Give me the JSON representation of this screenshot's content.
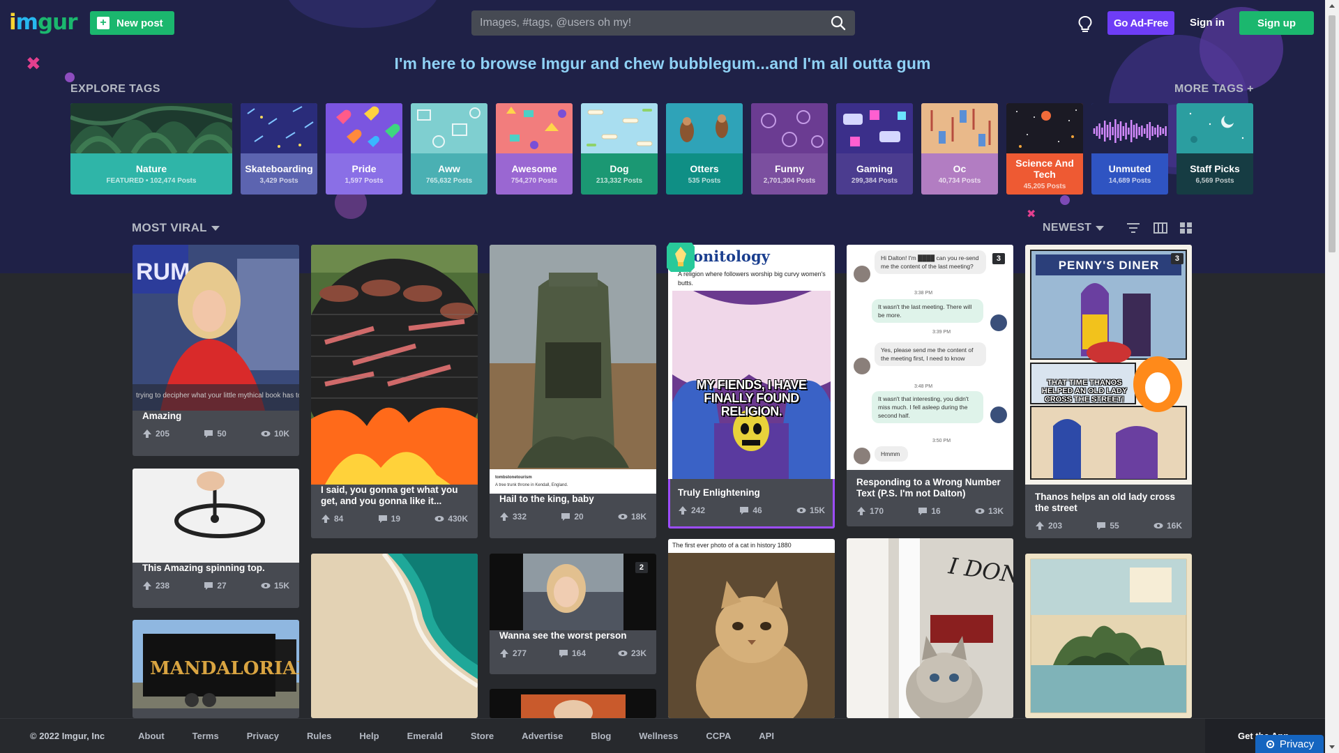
{
  "header": {
    "logo_text": "imgur",
    "new_post_label": "New post",
    "search_placeholder": "Images, #tags, @users oh my!",
    "go_ad_free_label": "Go Ad-Free",
    "sign_in_label": "Sign in",
    "sign_up_label": "Sign up",
    "icons": [
      "plus-icon",
      "search-icon",
      "lightbulb-icon"
    ]
  },
  "tagline": "I'm here to browse Imgur and chew bubblegum...and I'm all outta gum",
  "explore": {
    "title": "EXPLORE TAGS",
    "more_label": "MORE TAGS +",
    "tags": [
      {
        "name": "Nature",
        "count": "FEATURED • 102,474 Posts",
        "color": "#2fb5a8"
      },
      {
        "name": "Skateboarding",
        "count": "3,429 Posts",
        "color": "#5c64b0"
      },
      {
        "name": "Pride",
        "count": "1,597 Posts",
        "color": "#8a6fe6"
      },
      {
        "name": "Aww",
        "count": "765,632 Posts",
        "color": "#4ab0b3"
      },
      {
        "name": "Awesome",
        "count": "754,270 Posts",
        "color": "#9a67d2"
      },
      {
        "name": "Dog",
        "count": "213,332 Posts",
        "color": "#1b9873"
      },
      {
        "name": "Otters",
        "count": "535 Posts",
        "color": "#0f8f85"
      },
      {
        "name": "Funny",
        "count": "2,701,304 Posts",
        "color": "#7b4f9f"
      },
      {
        "name": "Gaming",
        "count": "299,384 Posts",
        "color": "#4b3c8f"
      },
      {
        "name": "Oc",
        "count": "40,734 Posts",
        "color": "#b27dc2"
      },
      {
        "name": "Science And Tech",
        "count": "45,205 Posts",
        "color": "#ee5a33"
      },
      {
        "name": "Unmuted",
        "count": "14,689 Posts",
        "color": "#2f54c2"
      },
      {
        "name": "Staff Picks",
        "count": "6,569 Posts",
        "color": "#163c43"
      }
    ]
  },
  "feed": {
    "section_label": "MOST VIRAL",
    "sort_label": "NEWEST",
    "posts": [
      {
        "title": "Amazing",
        "ups": "205",
        "comments": "50",
        "views": "10K",
        "caption": "trying to decipher what your little mythical book has to say"
      },
      {
        "title": "This Amazing spinning top.",
        "ups": "238",
        "comments": "27",
        "views": "15K"
      },
      {
        "title": "I said, you gonna get what you get, and you gonna like it...",
        "ups": "84",
        "comments": "19",
        "views": "430K"
      },
      {
        "title": "Hail to the king, baby",
        "ups": "332",
        "comments": "20",
        "views": "18K",
        "source": "tombstonetourism",
        "source_caption": "A tree trunk throne in Kendall, England."
      },
      {
        "title": "Wanna see the worst person",
        "ups": "277",
        "comments": "164",
        "views": "23K",
        "badge": "2"
      },
      {
        "title": "Truly Enlightening",
        "ups": "242",
        "comments": "46",
        "views": "15K",
        "heading": "onitology",
        "subheading": "A religion where followers worship big curvy women's butts.",
        "meme_text": "MY FIENDS, I HAVE FINALLY FOUND RELIGION."
      },
      {
        "title": "Responding to a Wrong Number Text (P.S. I'm not Dalton)",
        "ups": "170",
        "comments": "16",
        "views": "13K",
        "badge": "3"
      },
      {
        "title": "Thanos helps an old lady cross the street",
        "ups": "203",
        "comments": "55",
        "views": "16K",
        "badge": "3",
        "comic_title": "PENNY'S DINER",
        "comic_caption": "THAT TIME THANOS HELPED AN OLD LADY CROSS THE STREET!"
      },
      {
        "title": "The first ever photo of a cat in history 1880"
      }
    ],
    "chat": [
      {
        "from": "them",
        "text": "Hi Dalton! I'm ████ can you re-send me the content of the last meeting?",
        "time": "3:38 PM"
      },
      {
        "from": "me",
        "text": "It wasn't the last meeting. There will be more.",
        "time": "3:39 PM"
      },
      {
        "from": "them",
        "text": "Yes, please send me the content of the meeting first, I need to know",
        "time": "3:48 PM"
      },
      {
        "from": "me",
        "text": "It wasn't that interesting, you didn't miss much. I fell asleep during the second half.",
        "time": "3:50 PM"
      },
      {
        "from": "them",
        "text": "Hmmm",
        "time": ""
      }
    ],
    "mandalorian_text": "MANDALORIAN",
    "dont_text": "I DON'T HOW"
  },
  "footer": {
    "copyright": "© 2022 Imgur, Inc",
    "links": [
      "About",
      "Terms",
      "Privacy",
      "Rules",
      "Help",
      "Emerald",
      "Store",
      "Advertise",
      "Blog",
      "Wellness",
      "CCPA",
      "API"
    ],
    "get_app": "Get the App",
    "privacy_button": "Privacy"
  },
  "colors": {
    "hero_bg": "#1f2147",
    "page_bg": "#27292d",
    "brand_green": "#1bb76e",
    "ad_free_purple": "#6e3df6",
    "tagline": "#8fd1f5"
  }
}
